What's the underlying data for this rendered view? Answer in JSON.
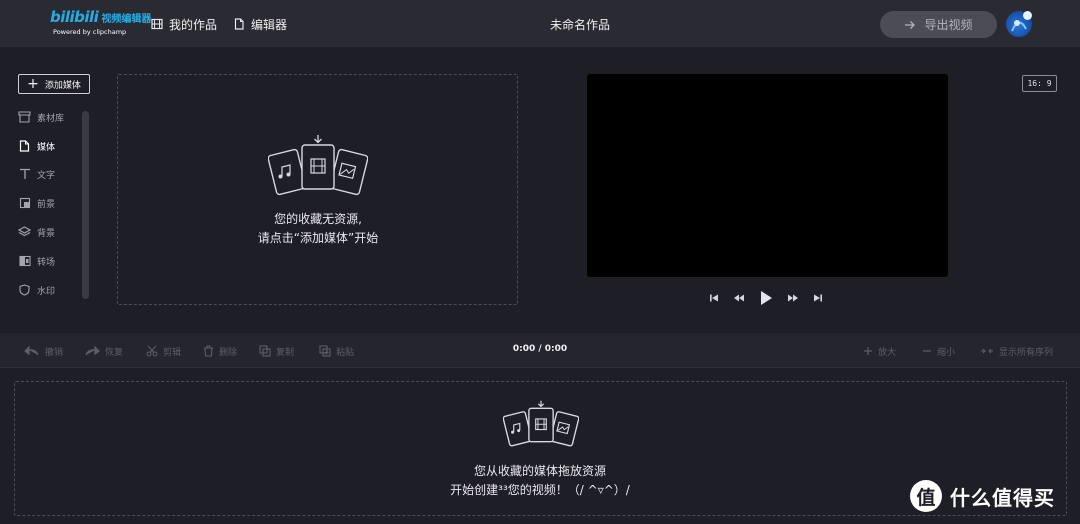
{
  "brand": {
    "logo_text": "bilibili",
    "app_name": "视频编辑器",
    "powered_by": "Powered by clipchamp"
  },
  "topnav": {
    "my_works": "我的作品",
    "editor": "编辑器",
    "project_title": "未命名作品",
    "export_label": "导出视频"
  },
  "sidebar": {
    "add_media": "添加媒体",
    "items": [
      {
        "label": "素材库",
        "icon": "store-icon",
        "active": false
      },
      {
        "label": "媒体",
        "icon": "file-icon",
        "active": true
      },
      {
        "label": "文字",
        "icon": "text-icon",
        "active": false
      },
      {
        "label": "前景",
        "icon": "foreground-icon",
        "active": false
      },
      {
        "label": "背景",
        "icon": "layers-icon",
        "active": false
      },
      {
        "label": "转场",
        "icon": "transition-icon",
        "active": false
      },
      {
        "label": "水印",
        "icon": "shield-icon",
        "active": false
      }
    ]
  },
  "media_panel": {
    "empty_line1": "您的收藏无资源,",
    "empty_line2": "请点击“添加媒体”开始"
  },
  "preview": {
    "aspect_ratio": "16: 9"
  },
  "toolbar": {
    "undo": "撤销",
    "redo": "恢复",
    "cut": "剪辑",
    "delete": "删除",
    "copy": "复制",
    "paste": "粘贴",
    "timecode": "0:00 / 0:00",
    "zoom_in": "放大",
    "zoom_out": "缩小",
    "show_all": "显示所有序列"
  },
  "timeline": {
    "empty_line1": "您从收藏的媒体拖放资源",
    "empty_line2": "开始创建³³您的视频！（/ ^▿^）/"
  },
  "watermark": {
    "symbol": "值",
    "text": "什么值得买"
  },
  "colors": {
    "background": "#1e1e27",
    "topbar": "#2a2a33",
    "accent": "#23ade5",
    "export_button": "#4c4c55"
  }
}
